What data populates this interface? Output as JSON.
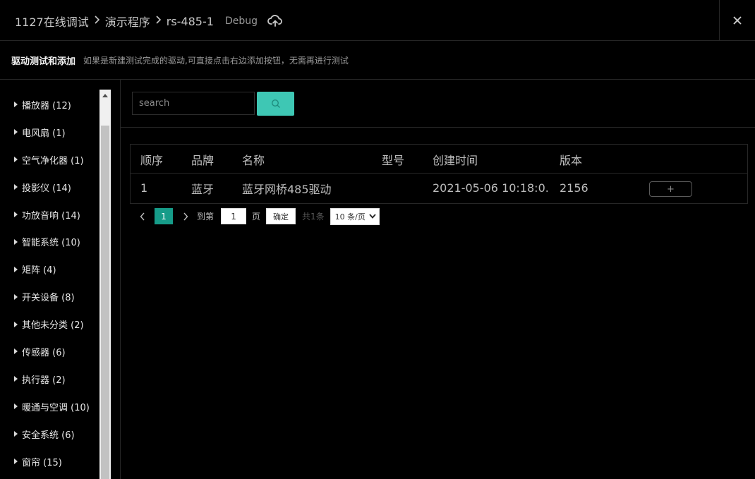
{
  "header": {
    "breadcrumb": [
      "1127在线调试",
      "演示程序",
      "rs-485-1"
    ],
    "mode": "Debug"
  },
  "subheader": {
    "title": "驱动测试和添加",
    "hint": "如果是新建测试完成的驱动,可直接点击右边添加按钮，无需再进行测试"
  },
  "sidebar": {
    "categories": [
      "播放器 (12)",
      "电风扇 (1)",
      "空气净化器 (1)",
      "投影仪 (14)",
      "功放音响 (14)",
      "智能系统 (10)",
      "矩阵 (4)",
      "开关设备 (8)",
      "其他未分类 (2)",
      "传感器 (6)",
      "执行器 (2)",
      "暖通与空调 (10)",
      "安全系统 (6)",
      "窗帘 (15)"
    ]
  },
  "search": {
    "placeholder": "search",
    "value": ""
  },
  "table": {
    "headers": [
      "顺序",
      "品牌",
      "名称",
      "型号",
      "创建时间",
      "版本"
    ],
    "rows": [
      {
        "order": "1",
        "brand": "蓝牙",
        "name": "蓝牙网桥485驱动",
        "model": "",
        "created": "2021-05-06 10:18:0...",
        "version": "2156",
        "action": "+"
      }
    ]
  },
  "pagination": {
    "current_page": "1",
    "goto_label": "到第",
    "goto_value": "1",
    "page_unit": "页",
    "confirm": "确定",
    "total": "共1条",
    "page_size": "10 条/页"
  },
  "colors": {
    "accent": "#3ec7b4",
    "page_active": "#169c89"
  },
  "icons": [
    "cloud-upload-icon",
    "close-icon",
    "search-icon",
    "chevron-left-icon",
    "chevron-right-icon",
    "chevron-down-icon",
    "caret-right-icon"
  ]
}
